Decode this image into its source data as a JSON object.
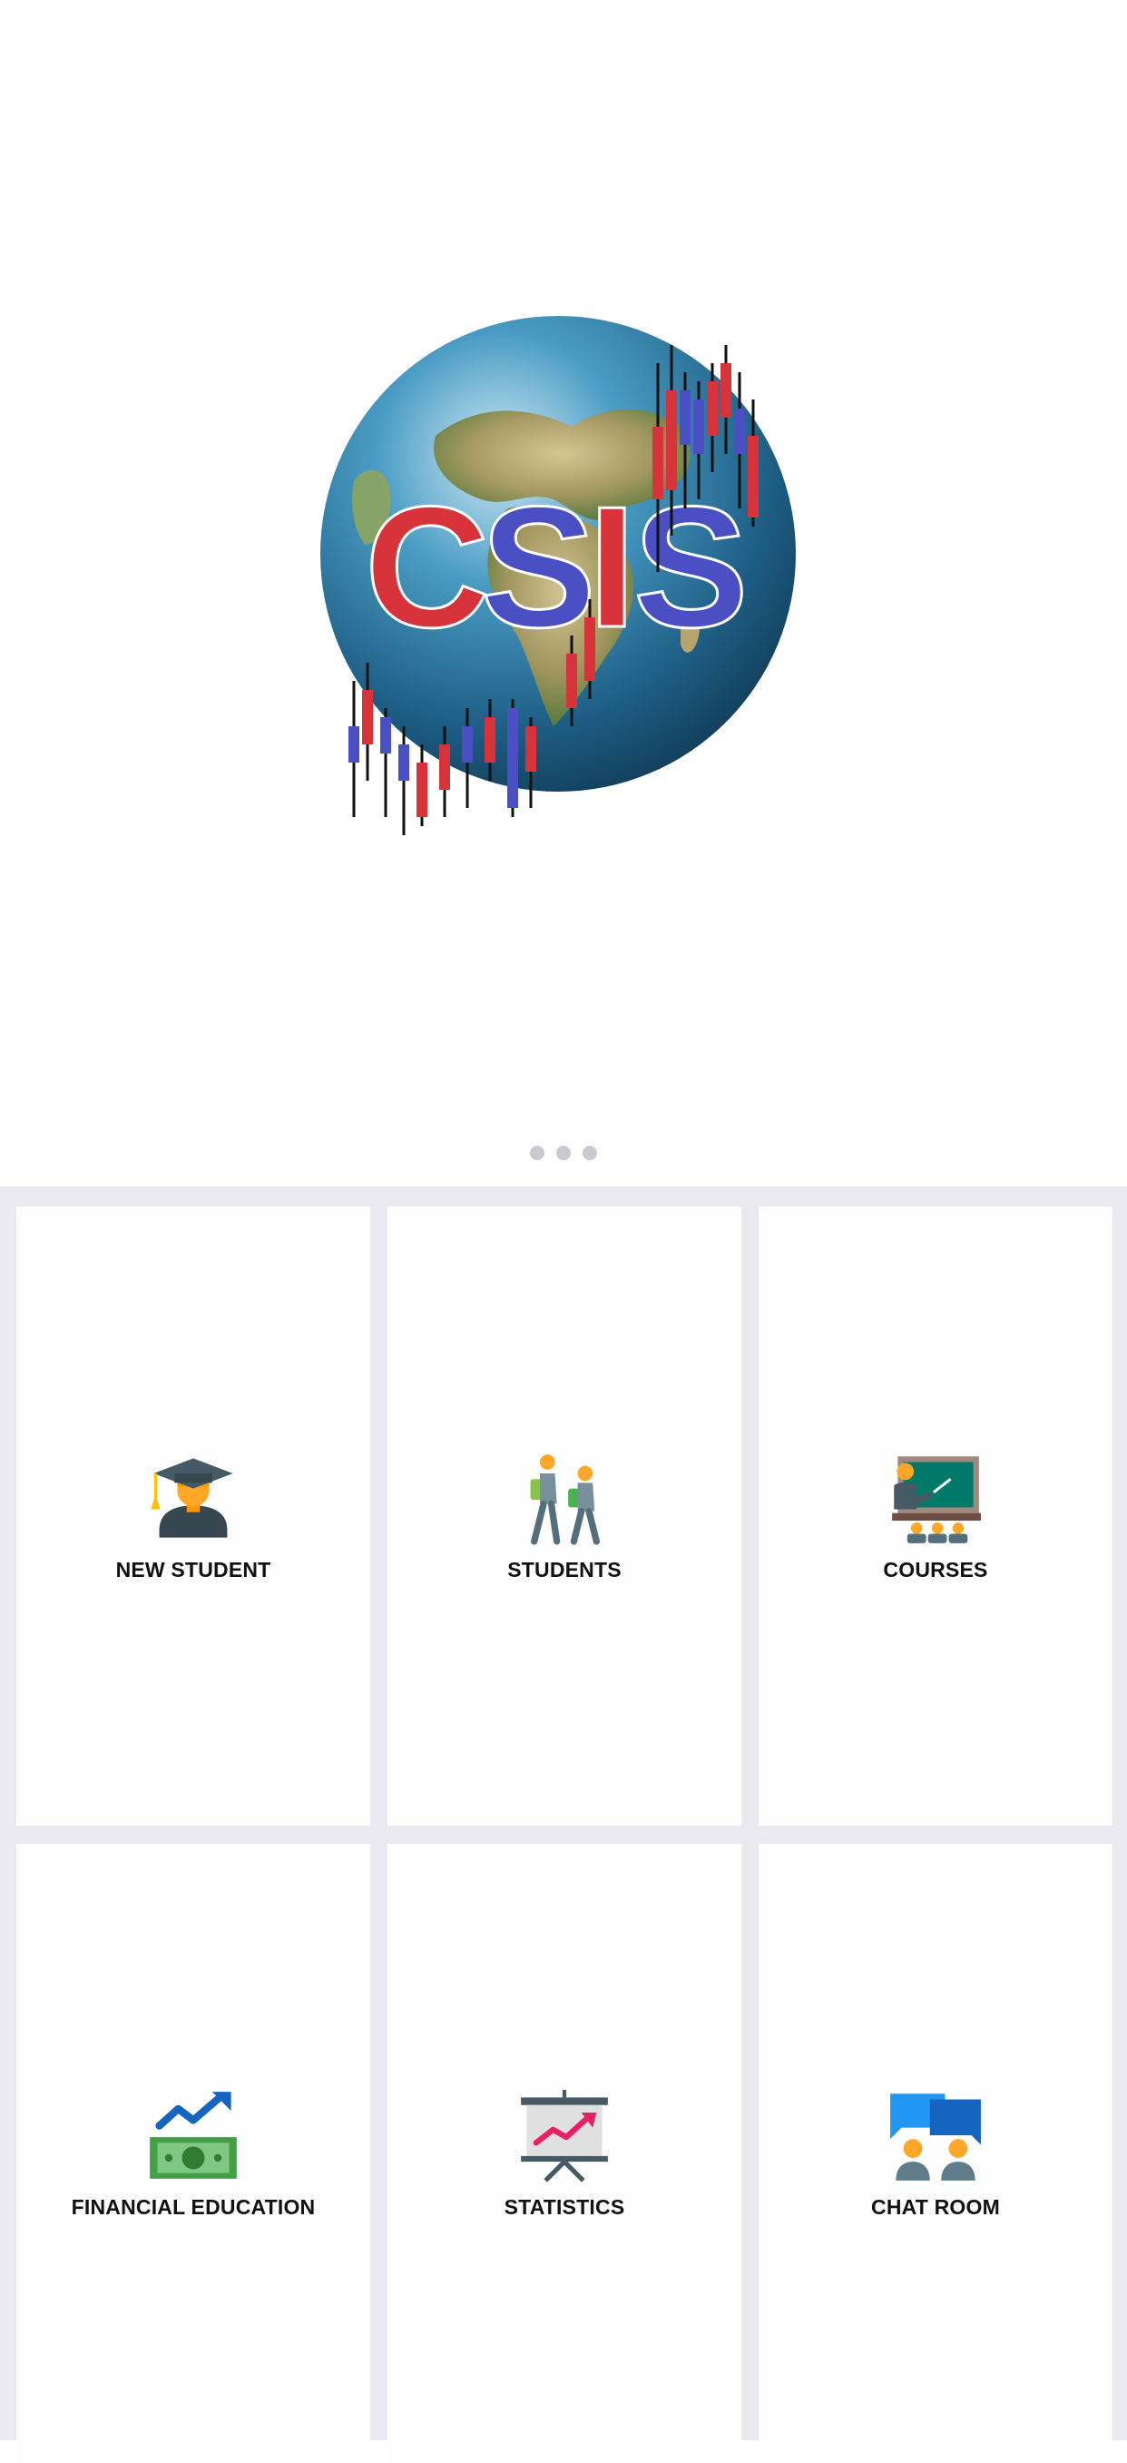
{
  "logo": {
    "text": "CSIS",
    "letter_colors": [
      "#d8323a",
      "#4a4fc4",
      "#d8323a",
      "#4a4fc4"
    ]
  },
  "carousel": {
    "page_count": 3
  },
  "tiles": [
    {
      "label": "NEW STUDENT",
      "icon": "graduate-icon"
    },
    {
      "label": "STUDENTS",
      "icon": "students-walking-icon"
    },
    {
      "label": "COURSES",
      "icon": "classroom-icon"
    },
    {
      "label": "FINANCIAL EDUCATION",
      "icon": "money-growth-icon"
    },
    {
      "label": "STATISTICS",
      "icon": "chart-board-icon"
    },
    {
      "label": "CHAT ROOM",
      "icon": "chat-room-icon"
    }
  ],
  "colors": {
    "grid_background": "#e9e9ef",
    "tile_background": "#fefefe",
    "dot": "#c9c9cf"
  }
}
